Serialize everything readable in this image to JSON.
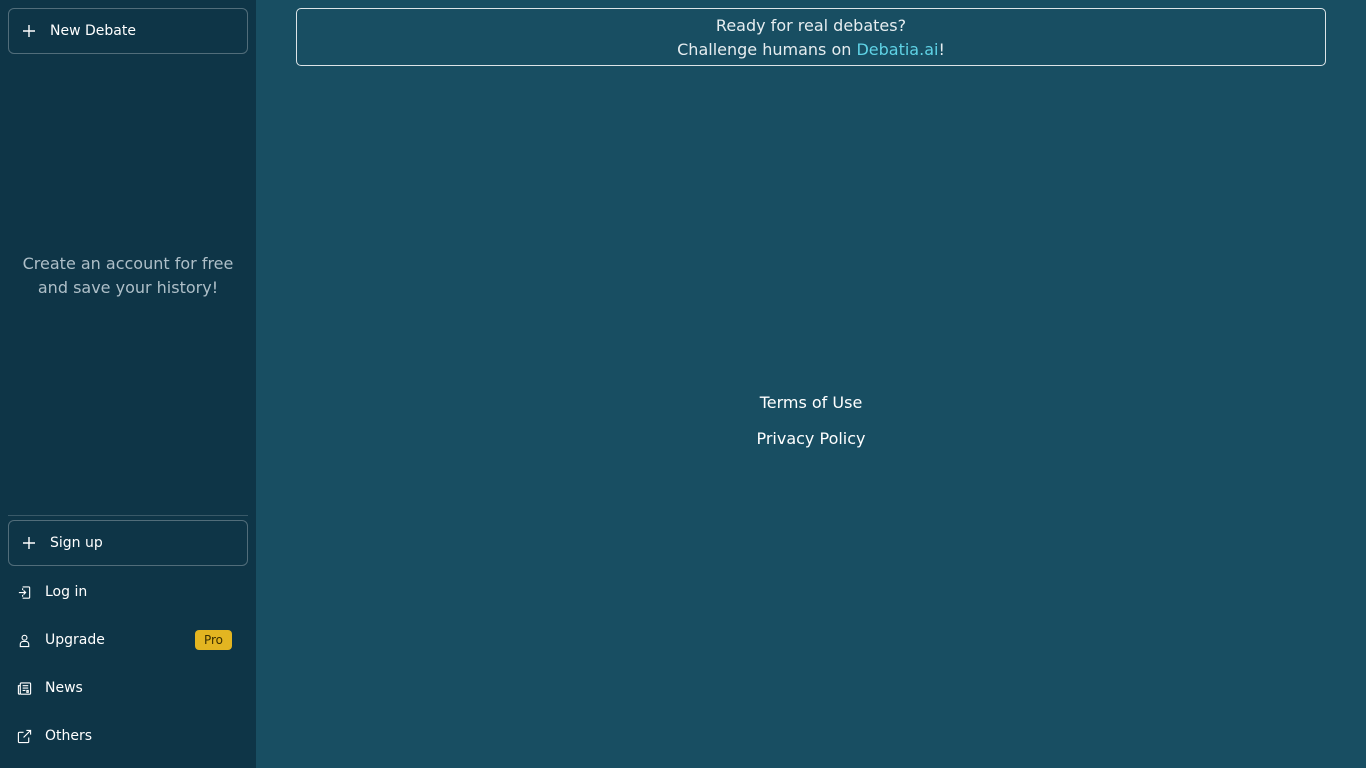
{
  "sidebar": {
    "new_debate": {
      "label": "New Debate",
      "icon": "plus-icon"
    },
    "empty_note": "Create an account for free and save your history!",
    "sign_up": {
      "label": "Sign up",
      "icon": "plus-icon"
    },
    "items": [
      {
        "label": "Log in",
        "icon": "login-icon"
      },
      {
        "label": "Upgrade",
        "icon": "user-icon",
        "badge": "Pro"
      },
      {
        "label": "News",
        "icon": "newspaper-icon"
      },
      {
        "label": "Others",
        "icon": "external-link-icon"
      }
    ]
  },
  "main": {
    "banner": {
      "line1": "Ready for real debates?",
      "line2_prefix": "Challenge humans on ",
      "link": "Debatia.ai",
      "line2_suffix": "!"
    },
    "footer": {
      "terms": "Terms of Use",
      "privacy": "Privacy Policy"
    }
  },
  "colors": {
    "sidebar_bg": "#0e3547",
    "main_bg": "#184e62",
    "link": "#5fd3e6",
    "pro_badge": "#e3b521"
  }
}
